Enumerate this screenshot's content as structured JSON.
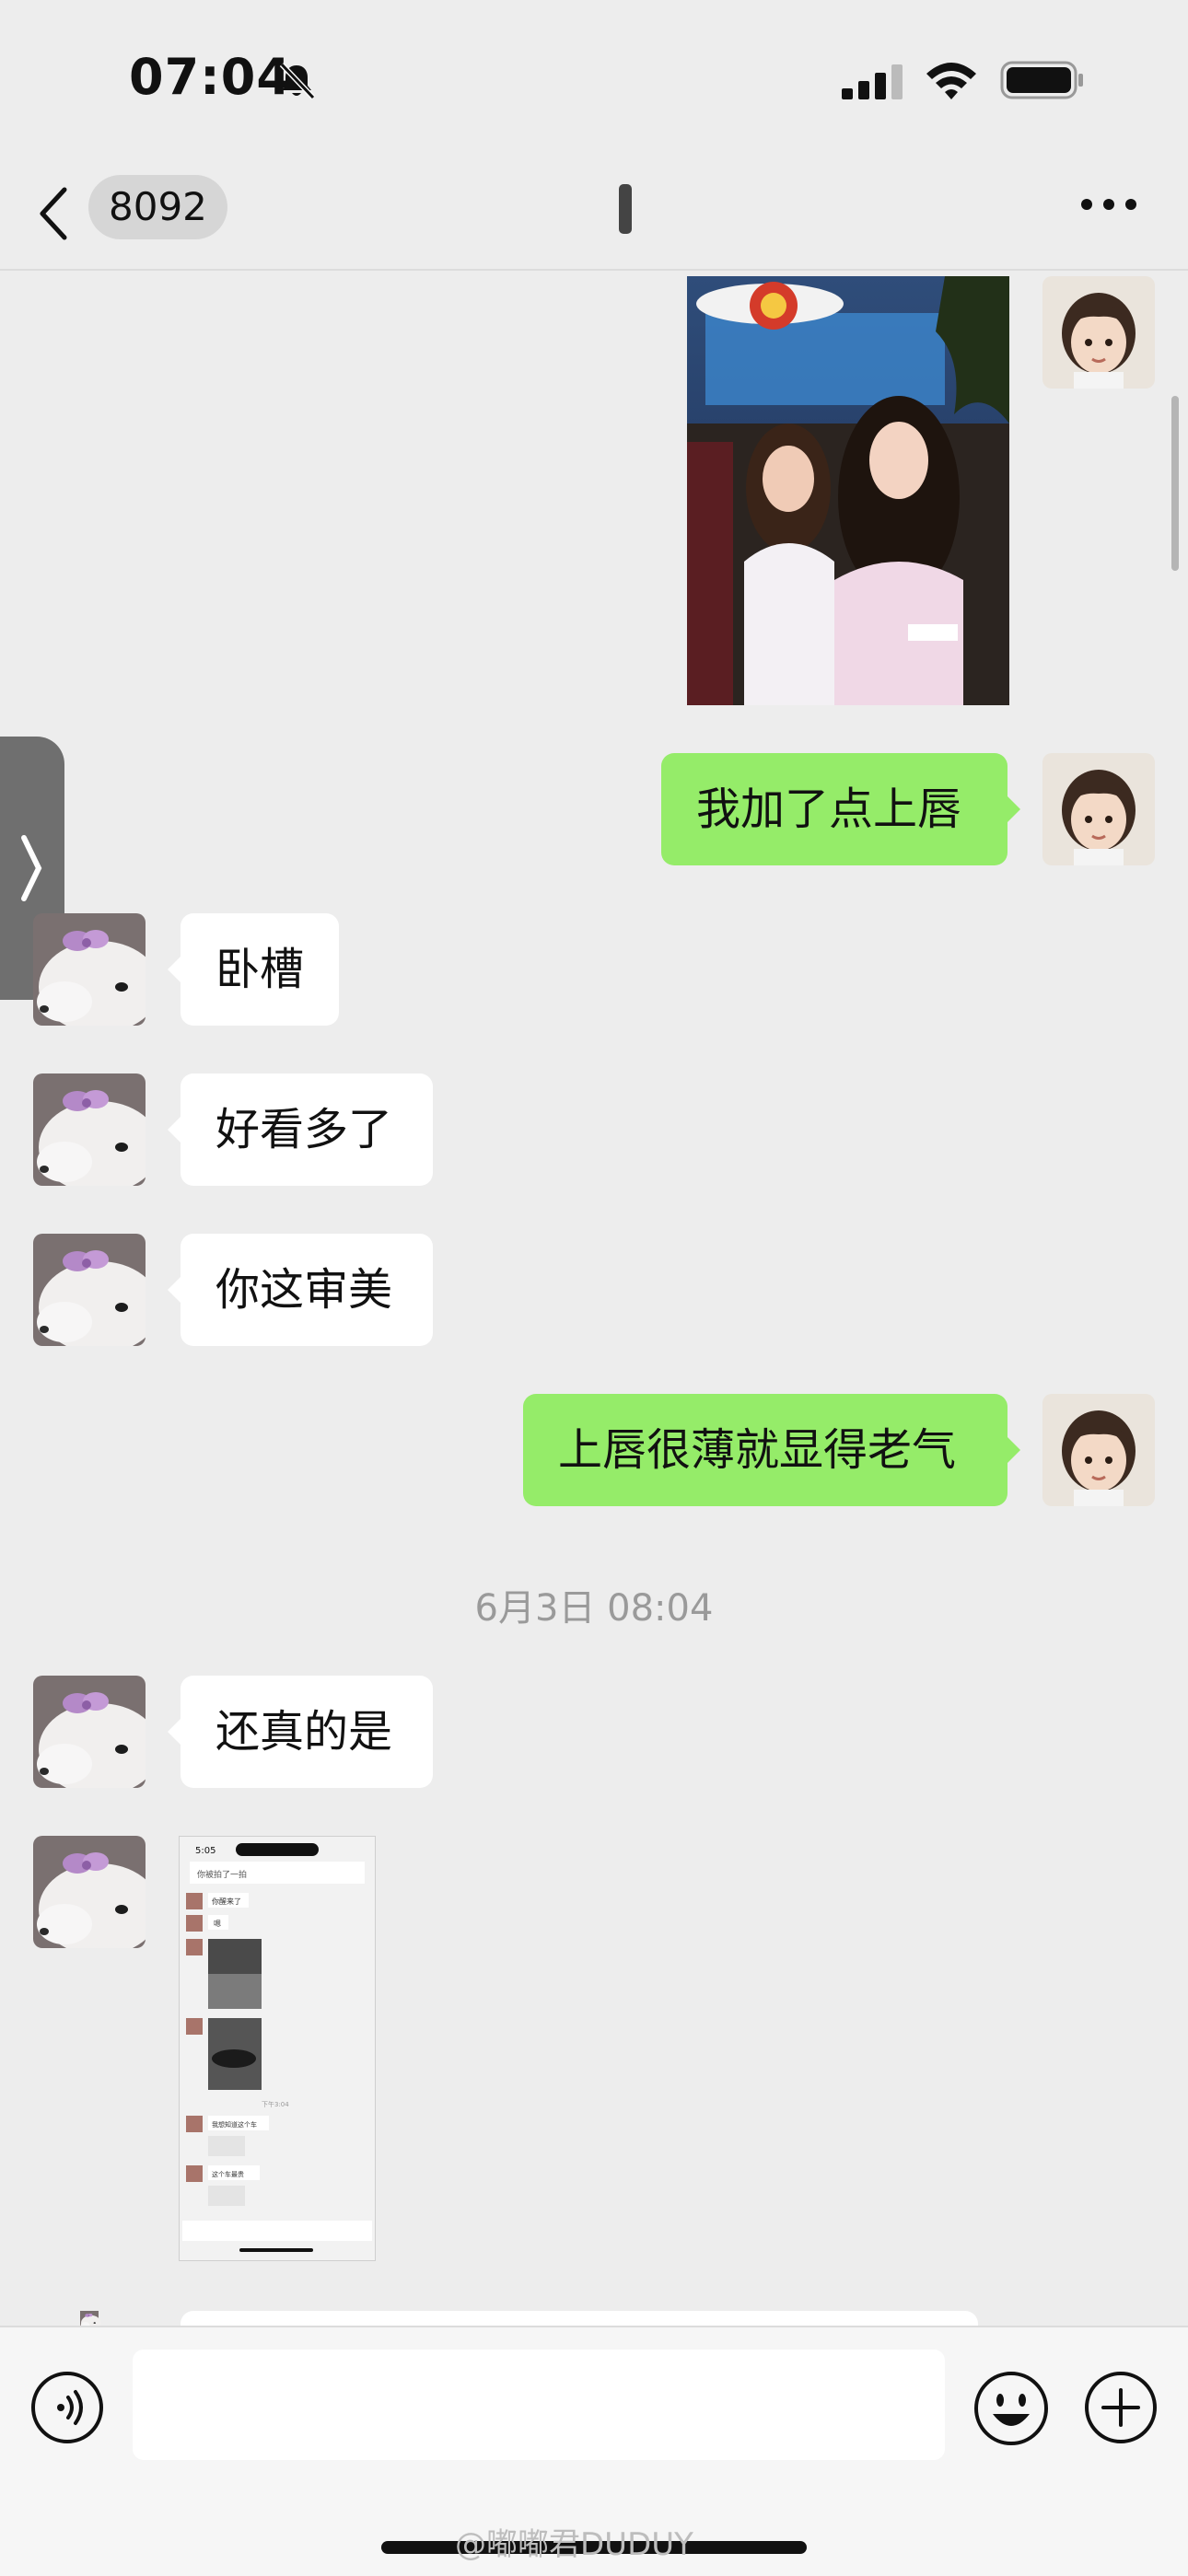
{
  "status_bar": {
    "time": "07:04"
  },
  "header": {
    "contact_badge": "8092"
  },
  "messages": {
    "m2_text": "我加了点上唇",
    "m3_text": "卧槽",
    "m4_text": "好看多了",
    "m5_text": "你这审美",
    "m6_text": "上唇很薄就显得老气",
    "timestamp": "6月3日 08:04",
    "m7_text": "还真的是"
  },
  "screenshot_thumb": {
    "time": "5:05",
    "pinned": "你被拍了一拍",
    "msg1": "你醒来了",
    "msg2": "嗯",
    "time_sep": "下午3:04",
    "msg3": "我想知道这个车",
    "msg4": "这个车最贵"
  },
  "watermark": "@嘟嘟君DUDUY",
  "colors": {
    "outgoing": "#95ec69",
    "incoming": "#ffffff",
    "background": "#ededed"
  }
}
